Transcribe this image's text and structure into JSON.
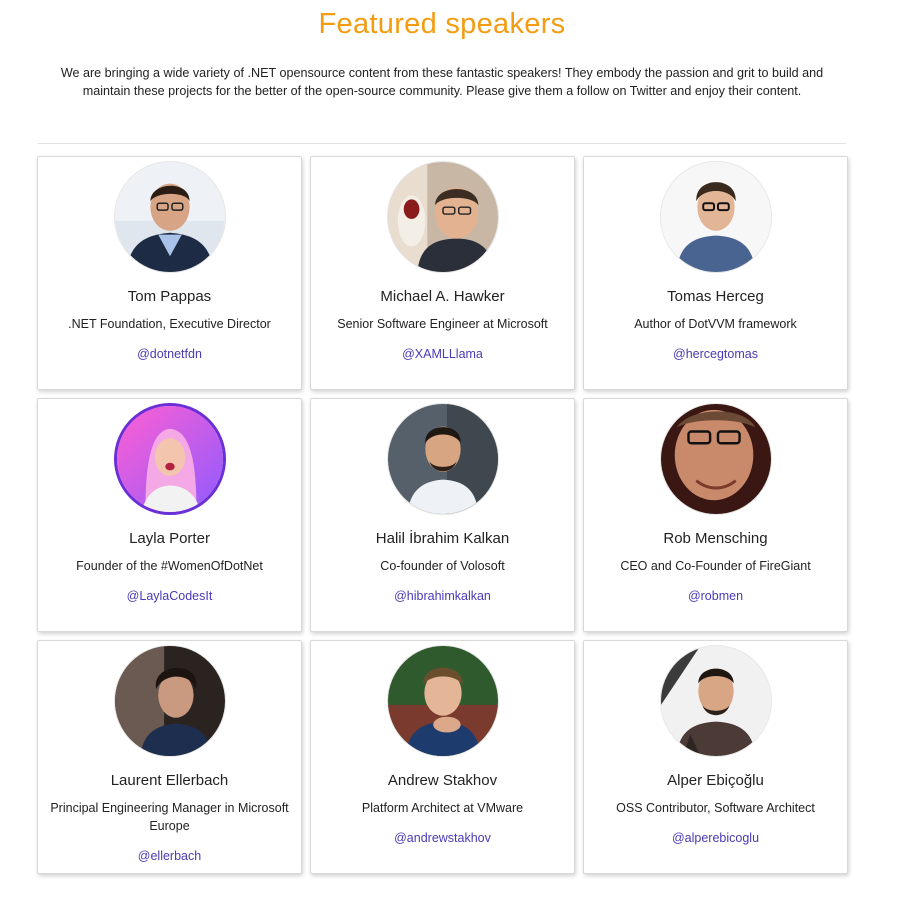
{
  "header": {
    "title": "Featured speakers",
    "intro": "We are bringing a wide variety of .NET opensource content from these fantastic speakers! They embody the passion and grit to build and maintain these projects for the better of the open-source community. Please give them a follow on Twitter and enjoy their content."
  },
  "colors": {
    "title": "#f39c12",
    "handle_link": "#4a3ab5",
    "avatar_ring": "#6b2fd6"
  },
  "speakers": [
    {
      "name": "Tom Pappas",
      "role": ".NET Foundation, Executive Director",
      "handle": "@dotnetfdn"
    },
    {
      "name": "Michael A. Hawker",
      "role": "Senior Software Engineer at Microsoft",
      "handle": "@XAMLLlama"
    },
    {
      "name": "Tomas Herceg",
      "role": "Author of DotVVM framework",
      "handle": "@hercegtomas"
    },
    {
      "name": "Layla Porter",
      "role": "Founder of the #WomenOfDotNet",
      "handle": "@LaylaCodesIt"
    },
    {
      "name": "Halil İbrahim Kalkan",
      "role": "Co-founder of Volosoft",
      "handle": "@hibrahimkalkan"
    },
    {
      "name": "Rob Mensching",
      "role": "CEO and Co-Founder of FireGiant",
      "handle": "@robmen"
    },
    {
      "name": "Laurent Ellerbach",
      "role": "Principal Engineering Manager in Microsoft Europe",
      "handle": "@ellerbach"
    },
    {
      "name": "Andrew Stakhov",
      "role": "Platform Architect at VMware",
      "handle": "@andrewstakhov"
    },
    {
      "name": "Alper Ebiçoğlu",
      "role": "OSS Contributor, Software Architect",
      "handle": "@alperebicoglu"
    }
  ]
}
